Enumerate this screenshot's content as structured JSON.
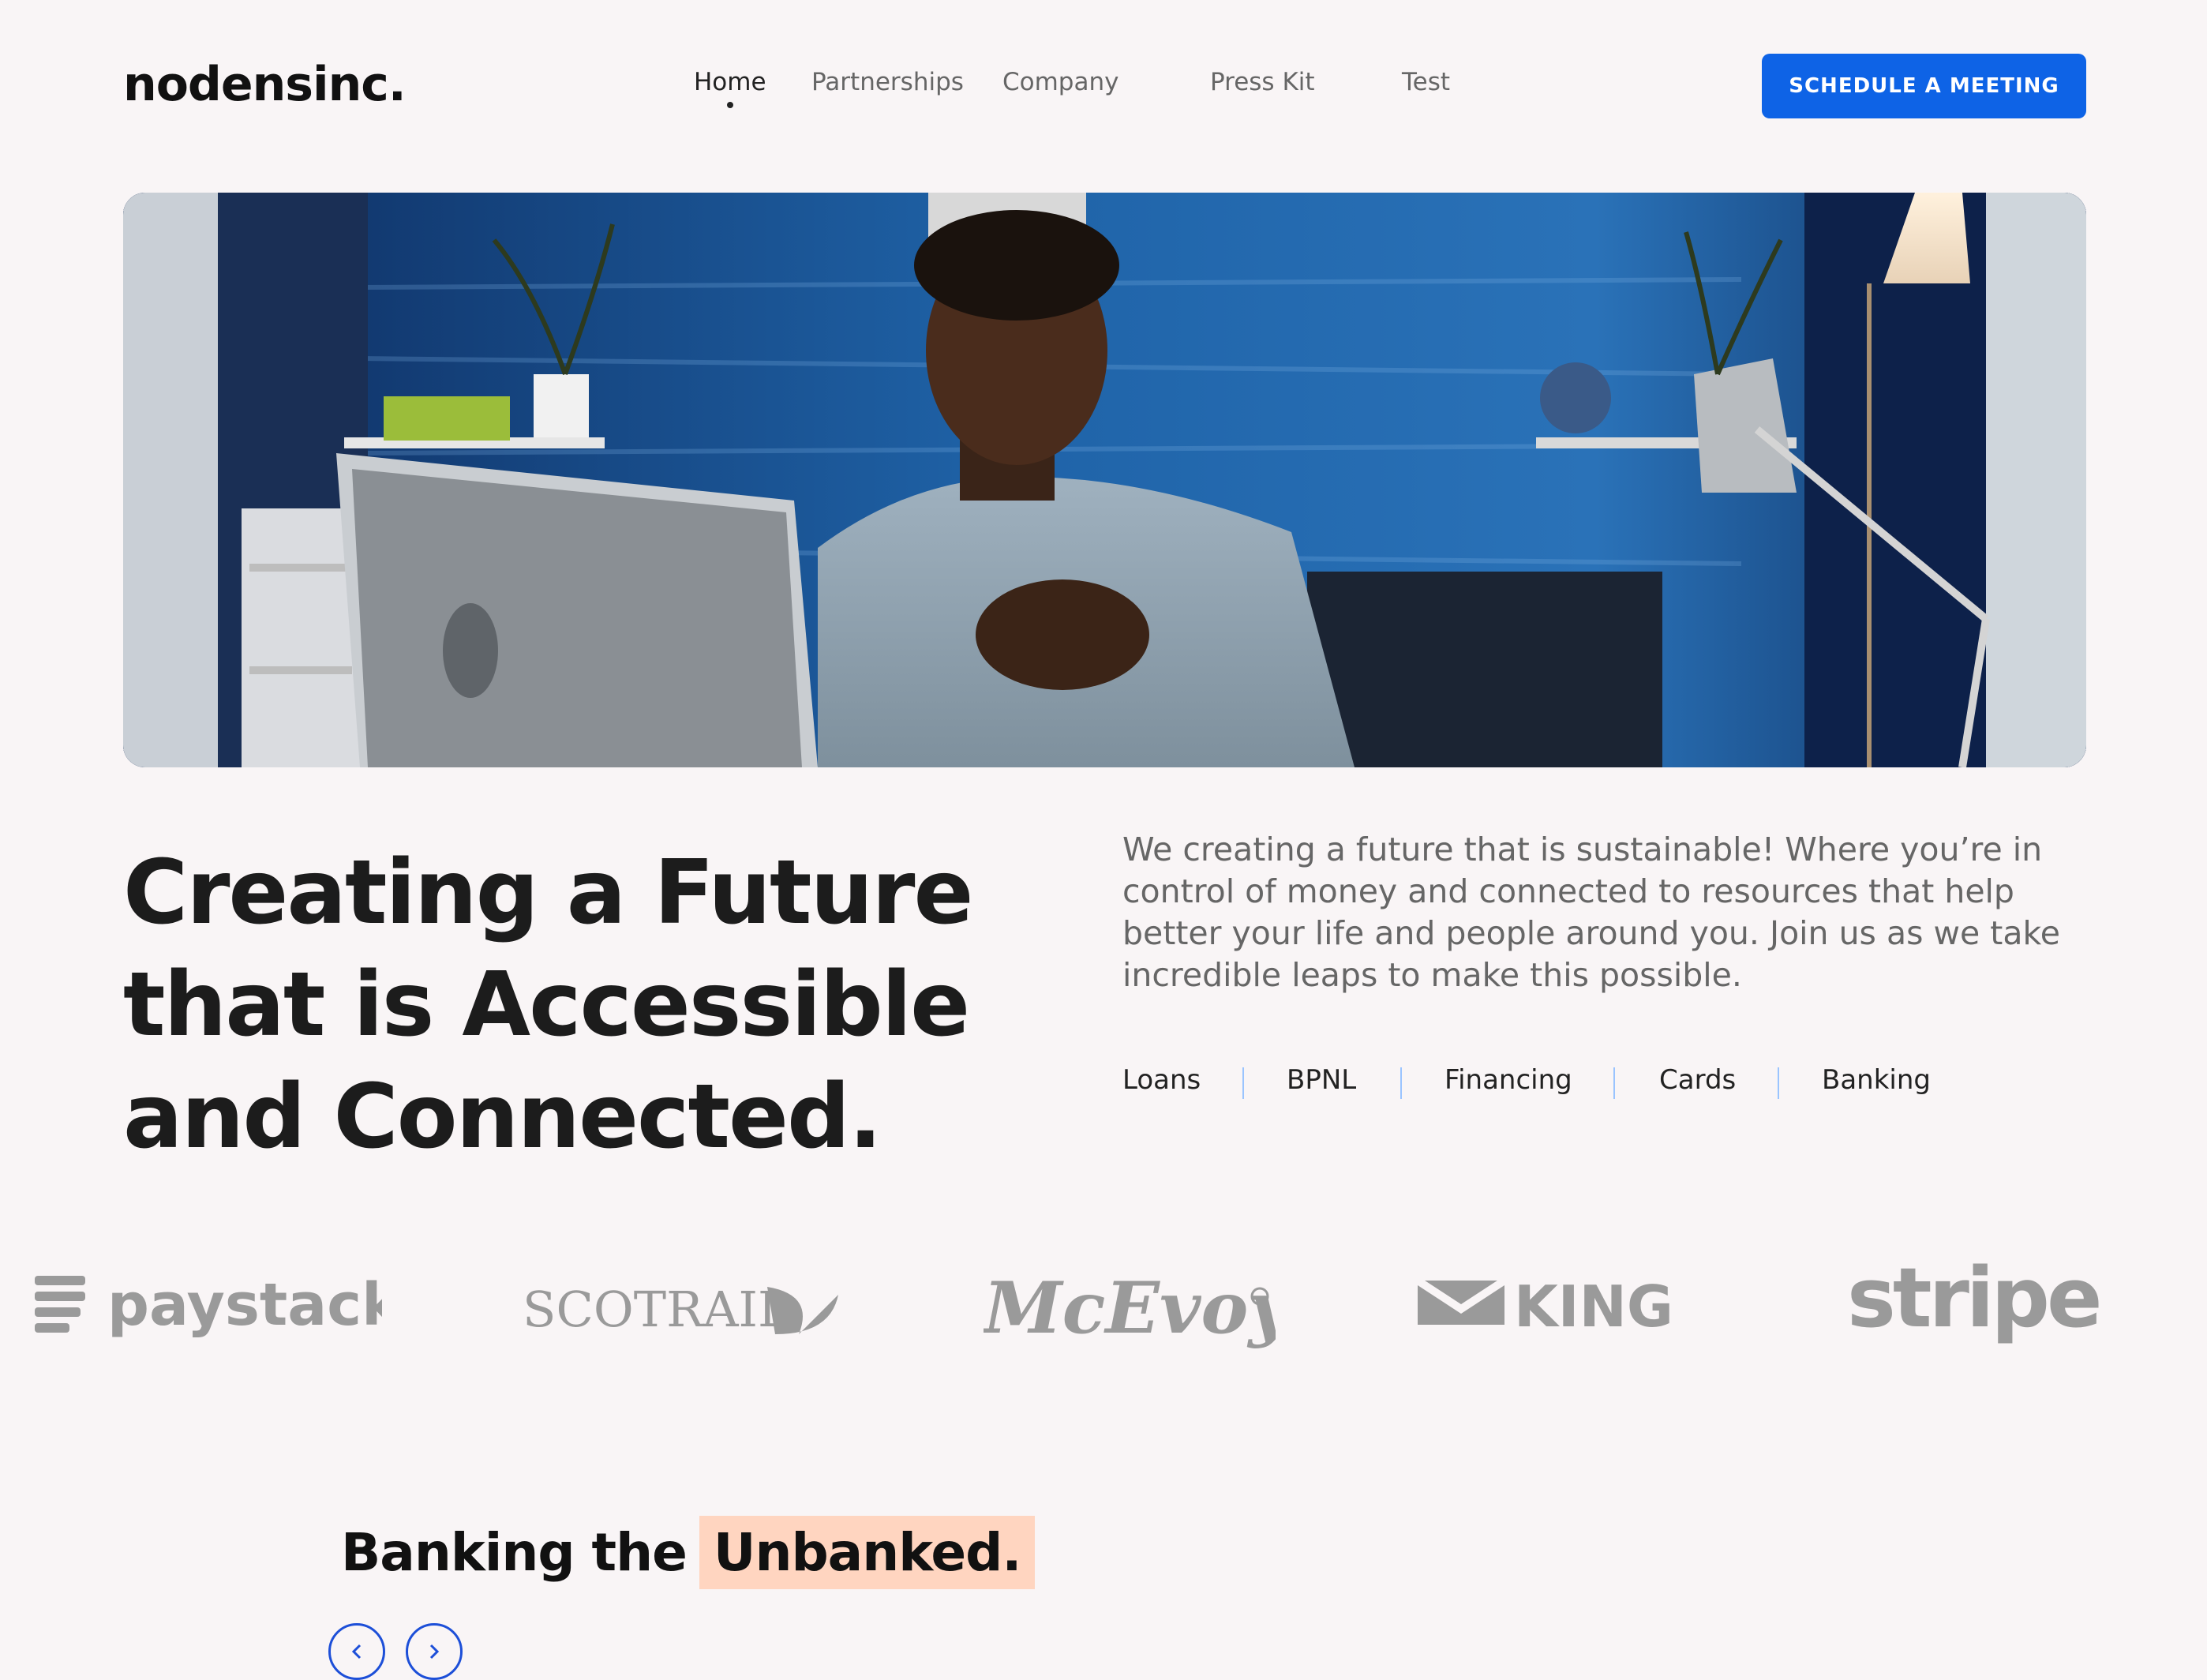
{
  "brand": {
    "logo_text": "nodensinc."
  },
  "nav": {
    "items": [
      {
        "label": "Home",
        "active": true
      },
      {
        "label": "Partnerships"
      },
      {
        "label": "Company"
      },
      {
        "label": "Press Kit"
      },
      {
        "label": "Test"
      }
    ]
  },
  "header": {
    "cta_label": "SCHEDULE A MEETING"
  },
  "hero": {
    "headline_lines": [
      "Creating a Future",
      "that is Accessible",
      "and Connected."
    ],
    "intro": "We creating a future that is sustainable! Where you’re in control of money and connected to resources that help better your life and people around you. Join us as we take incredible leaps to make this possible."
  },
  "services": [
    "Loans",
    "BPNL",
    "Financing",
    "Cards",
    "Banking"
  ],
  "partners": [
    "paystack",
    "SCOTRAIL",
    "McEvoy",
    "KING",
    "stripe"
  ],
  "section": {
    "title_plain": "Banking the",
    "title_highlight": "Unbanked."
  },
  "carousel": {
    "prev_icon": "chevron-left-icon",
    "next_icon": "chevron-right-icon"
  },
  "colors": {
    "background": "#f9f5f6",
    "accent": "#0e63e6",
    "highlight": "#ffd5c0",
    "muted_text": "#666666",
    "partner_gray": "#9a9a9a"
  }
}
